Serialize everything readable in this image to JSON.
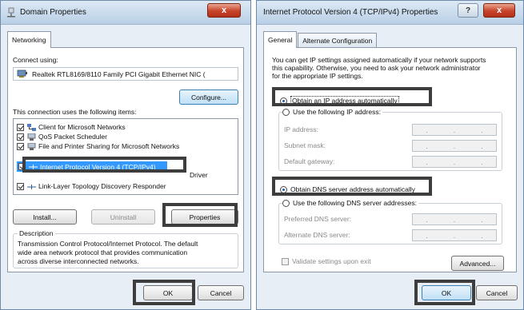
{
  "left_dialog": {
    "title": "Domain Properties",
    "tabs": [
      "Networking"
    ],
    "connect_using_label": "Connect using:",
    "adapter_name": "Realtek RTL8169/8110 Family PCI Gigabit Ethernet NIC (",
    "configure_button": "Configure...",
    "items_label": "This connection uses the following items:",
    "items": [
      {
        "label": "Client for Microsoft Networks",
        "checked": true
      },
      {
        "label": "QoS Packet Scheduler",
        "checked": true
      },
      {
        "label": "File and Printer Sharing for Microsoft Networks",
        "checked": true
      },
      {
        "label": "Internet Protocol Version 4 (TCP/IPv4)",
        "checked": true,
        "selected": true
      },
      {
        "label": "Driver",
        "checked": true
      },
      {
        "label": "Link-Layer Topology Discovery Responder",
        "checked": true
      }
    ],
    "install_button": "Install...",
    "uninstall_button": "Uninstall",
    "properties_button": "Properties",
    "description_legend": "Description",
    "description_text": [
      "Transmission Control Protocol/Internet Protocol. The default",
      "wide area network protocol that provides communication",
      "across diverse interconnected networks."
    ],
    "ok_button": "OK",
    "cancel_button": "Cancel",
    "close_glyph": "x"
  },
  "right_dialog": {
    "title": "Internet Protocol Version 4 (TCP/IPv4) Properties",
    "help_glyph": "?",
    "close_glyph": "x",
    "tabs": [
      "General",
      "Alternate Configuration"
    ],
    "intro_text": [
      "You can get IP settings assigned automatically if your network supports",
      "this capability. Otherwise, you need to ask your network administrator",
      "for the appropriate IP settings."
    ],
    "radio_auto_ip": "Obtain an IP address automatically",
    "radio_manual_ip": "Use the following IP address:",
    "ip_address_label": "IP address:",
    "subnet_mask_label": "Subnet mask:",
    "default_gateway_label": "Default gateway:",
    "radio_auto_dns": "Obtain DNS server address automatically",
    "radio_manual_dns": "Use the following DNS server addresses:",
    "preferred_dns_label": "Preferred DNS server:",
    "alternate_dns_label": "Alternate DNS server:",
    "ip_dot": ".",
    "validate_checkbox": "Validate settings upon exit",
    "advanced_button": "Advanced...",
    "ok_button": "OK",
    "cancel_button": "Cancel"
  },
  "colors": {
    "highlight_border": "#3d3d3d",
    "selection": "#3399ff",
    "titlebar": "#c5d7ea",
    "close_button": "#c7432a"
  }
}
